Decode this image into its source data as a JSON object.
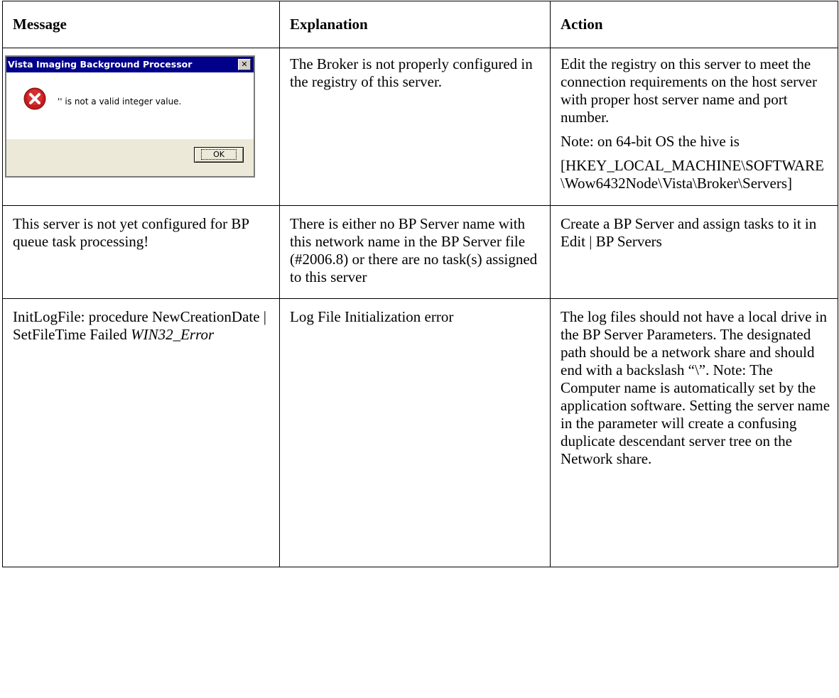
{
  "headers": {
    "message": "Message",
    "explanation": "Explanation",
    "action": "Action"
  },
  "dialog": {
    "title": "Vista Imaging Background Processor",
    "close_glyph": "✕",
    "icon": "error-icon",
    "text": "'' is not a valid integer value.",
    "ok_label": "OK"
  },
  "rows": [
    {
      "explanation": "The Broker is not properly configured in the registry of this server.",
      "action_lines": [
        "Edit the registry on this server to meet the connection requirements on the host server with proper host server name and port number.",
        "Note: on 64-bit OS the hive is",
        "[HKEY_LOCAL_MACHINE\\SOFTWARE\\Wow6432Node\\Vista\\Broker\\Servers]"
      ]
    },
    {
      "message": "This server is not yet configured for BP queue task processing!",
      "explanation": "There is either no BP Server name with this network name in the BP Server file (#2006.8) or there are no task(s) assigned to this server",
      "action": "Create a BP Server and assign tasks to it in Edit | BP Servers"
    },
    {
      "message_prefix": "InitLogFile: procedure NewCreationDate | SetFileTime Failed ",
      "message_italic": "WIN32_Error",
      "explanation": "Log File Initialization error",
      "action": "The log files should not have a local drive in the BP Server Parameters. The designated path should be a network share and should end with a backslash “\\”. Note: The Computer name is automatically set by the application software. Setting the server name in the parameter will create a confusing duplicate descendant server tree on the Network share."
    }
  ]
}
